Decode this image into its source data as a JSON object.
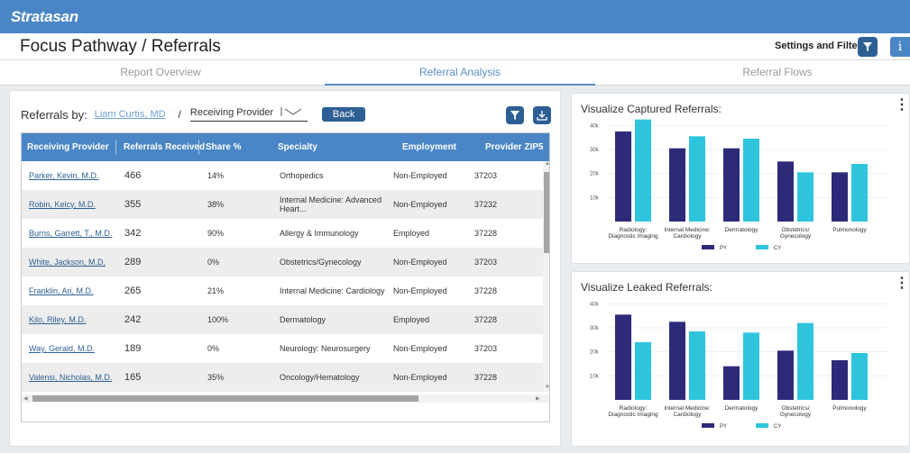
{
  "app": {
    "logo": "Stratasan"
  },
  "header": {
    "title": "Focus Pathway / Referrals",
    "settings_label": "Settings and Filters:"
  },
  "tabs": [
    {
      "label": "Report Overview",
      "active": false
    },
    {
      "label": "Referral Analysis",
      "active": true
    },
    {
      "label": "Referral Flows",
      "active": false
    }
  ],
  "controls": {
    "referrals_by_label": "Referrals by:",
    "provider_link": "Liam Curtis, MD",
    "separator": "/",
    "select_value": "Receiving Provider",
    "back_label": "Back"
  },
  "table": {
    "columns": [
      "Receiving Provider",
      "Referrals Received",
      "Share %",
      "Specialty",
      "Employment",
      "Provider ZIP5"
    ],
    "rows": [
      [
        "Parker, Kevin, M.D.",
        "466",
        "14%",
        "Orthopedics",
        "Non-Employed",
        "37203"
      ],
      [
        "Robin, Kelcy, M.D.",
        "355",
        "38%",
        "Internal Medicine: Advanced Heart...",
        "Non-Employed",
        "37232"
      ],
      [
        "Burns, Garrett, T., M.D.",
        "342",
        "90%",
        "Allergy & Immunology",
        "Employed",
        "37228"
      ],
      [
        "White, Jackson, M.D.",
        "289",
        "0%",
        "Obstetrics/Gynecology",
        "Non-Employed",
        "37203"
      ],
      [
        "Franklin, Ari, M.D.",
        "265",
        "21%",
        "Internal Medicine: Cardiology",
        "Non-Employed",
        "37228"
      ],
      [
        "Kilo, Riley, M.D.",
        "242",
        "100%",
        "Dermatology",
        "Employed",
        "37228"
      ],
      [
        "Way, Gerald, M.D.",
        "189",
        "0%",
        "Neurology: Neurosurgery",
        "Non-Employed",
        "37203"
      ],
      [
        "Valensi, Nicholas, M.D.",
        "165",
        "35%",
        "Oncology/Hematology",
        "Non-Employed",
        "37228"
      ]
    ]
  },
  "charts": {
    "captured_title": "Visualize Captured Referrals:",
    "leaked_title": "Visualize Leaked Referrals:"
  },
  "colors": {
    "brand": "#4a86c6",
    "dark_button": "#2e5f94",
    "py": "#2e2a7a",
    "cy": "#2ec4dc"
  },
  "chart_data": [
    {
      "type": "bar",
      "title": "Visualize Captured Referrals:",
      "categories": [
        "Radiology: Diagnostic Imaging",
        "Internal Medicine: Cardiology",
        "Dermatology",
        "Obstetrics/ Gynecology",
        "Pulmonology"
      ],
      "series": [
        {
          "name": "PY",
          "values": [
            37500,
            30500,
            30500,
            25000,
            20500
          ]
        },
        {
          "name": "CY",
          "values": [
            42500,
            35500,
            34500,
            20500,
            24000
          ]
        }
      ],
      "yticks": [
        "40k",
        "30k",
        "20k",
        "10k"
      ],
      "ylim": [
        0,
        45000
      ],
      "legend": "bottom"
    },
    {
      "type": "bar",
      "title": "Visualize Leaked Referrals:",
      "categories": [
        "Radiology: Diagnostic Imaging",
        "Internal Medicine: Cardiology",
        "Dermatology",
        "Obstetrics/ Gynecology",
        "Pulmonology"
      ],
      "series": [
        {
          "name": "PY",
          "values": [
            35500,
            32500,
            14000,
            20500,
            16500
          ]
        },
        {
          "name": "CY",
          "values": [
            24000,
            28500,
            28000,
            32000,
            19500
          ]
        }
      ],
      "yticks": [
        "40k",
        "30k",
        "20k",
        "10k"
      ],
      "ylim": [
        0,
        45000
      ],
      "legend": "bottom"
    }
  ]
}
